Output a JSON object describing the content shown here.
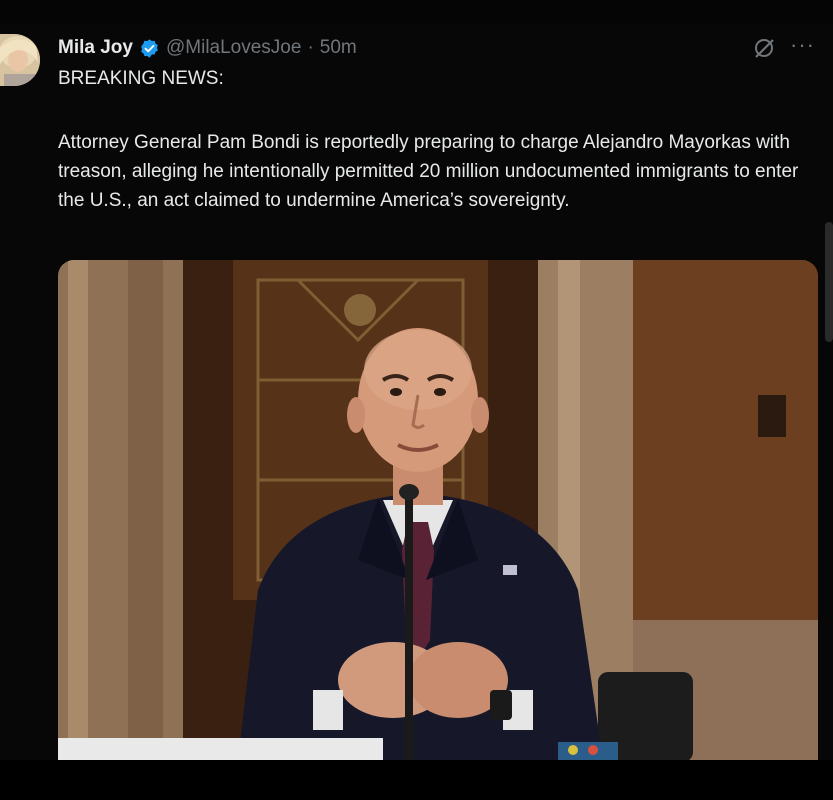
{
  "tweet": {
    "display_name": "Mila Joy",
    "handle": "@MilaLovesJoe",
    "separator": "·",
    "time": "50m",
    "headline": "BREAKING NEWS:",
    "body": "Attorney General Pam Bondi is reportedly preparing to charge Alejandro Mayorkas with treason, alleging he intentionally permitted 20 million undocumented immigrants to enter the U.S., an act claimed to undermine America’s sovereignty.",
    "more_glyph": "···"
  },
  "icons": {
    "avatar": "avatar",
    "verified": "verified-badge-icon",
    "grok": "grok-icon",
    "more": "more-options-icon"
  },
  "colors": {
    "background": "#070707",
    "text": "#e7e9ea",
    "secondary": "#71767b",
    "verified": "#1d9bf0"
  }
}
